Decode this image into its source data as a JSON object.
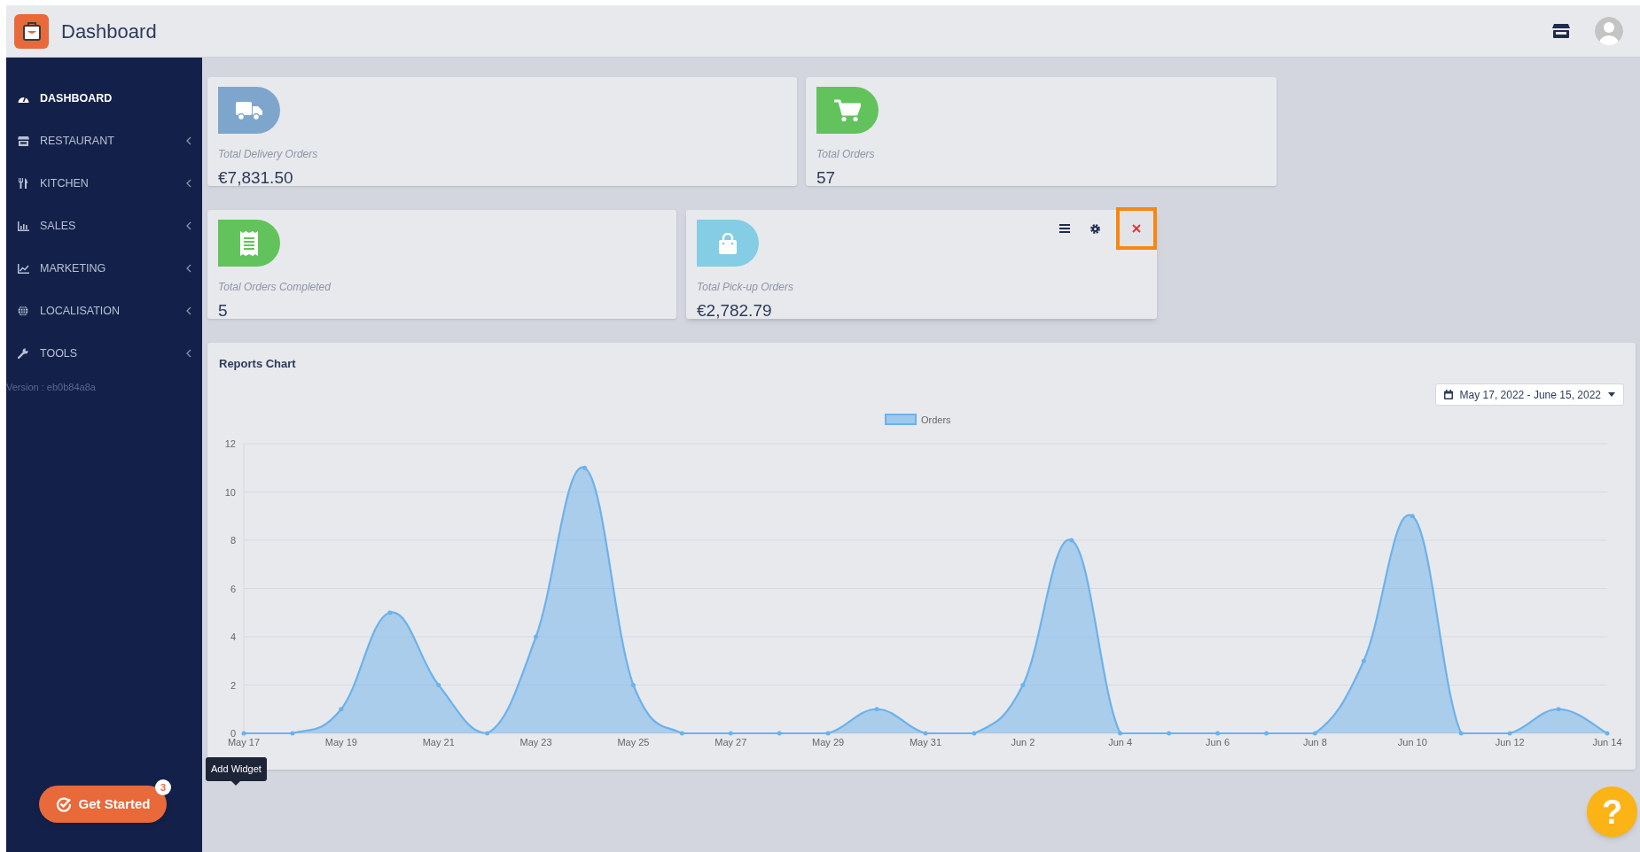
{
  "header": {
    "title": "Dashboard"
  },
  "sidebar": {
    "items": [
      {
        "label": "DASHBOARD",
        "kind": "link",
        "selected": true
      },
      {
        "label": "RESTAURANT",
        "kind": "group",
        "selected": false
      },
      {
        "label": "KITCHEN",
        "kind": "group",
        "selected": false
      },
      {
        "label": "SALES",
        "kind": "group",
        "selected": false
      },
      {
        "label": "MARKETING",
        "kind": "group",
        "selected": false
      },
      {
        "label": "LOCALISATION",
        "kind": "group",
        "selected": false
      },
      {
        "label": "TOOLS",
        "kind": "group",
        "selected": false
      }
    ],
    "version": "Version : eb0b84a8a"
  },
  "cards": [
    {
      "kind": "delivery",
      "color": "#7ea6cc",
      "label": "Total Delivery Orders",
      "value": "€7,831.50",
      "hovered": false
    },
    {
      "kind": "orders",
      "color": "#62c35c",
      "label": "Total Orders",
      "value": "57",
      "hovered": false
    },
    {
      "kind": "completed",
      "color": "#62c35c",
      "label": "Total Orders Completed",
      "value": "5",
      "hovered": false
    },
    {
      "kind": "pickup",
      "color": "#84cde4",
      "label": "Total Pick-up Orders",
      "value": "€2,782.79",
      "hovered": true
    }
  ],
  "reports": {
    "title": "Reports Chart",
    "date_range": "May 17, 2022 - June 15, 2022",
    "chart_data": {
      "type": "area",
      "categories": [
        "May 17",
        null,
        "May 19",
        null,
        "May 21",
        null,
        "May 23",
        null,
        "May 25",
        null,
        "May 27",
        null,
        "May 29",
        null,
        "May 31",
        null,
        "Jun 2",
        null,
        "Jun 4",
        null,
        "Jun 6",
        null,
        "Jun 8",
        null,
        "Jun 10",
        null,
        "Jun 12",
        null,
        "Jun 14"
      ],
      "yticks": [
        0,
        2,
        4,
        6,
        8,
        10,
        12
      ],
      "ylim": [
        0,
        12
      ],
      "grid": true,
      "series": [
        {
          "name": "Orders",
          "color": "#6cb2eb",
          "values": [
            0,
            0,
            1,
            5,
            2,
            0,
            4,
            11,
            2,
            0,
            0,
            0,
            0,
            1,
            0,
            0,
            2,
            8,
            0,
            0,
            0,
            0,
            0,
            3,
            9,
            0,
            0,
            1,
            0
          ]
        }
      ]
    }
  },
  "tooltip": "Add Widget",
  "get_started": {
    "label": "Get Started",
    "badge": "3"
  },
  "help": {
    "label": "?"
  }
}
